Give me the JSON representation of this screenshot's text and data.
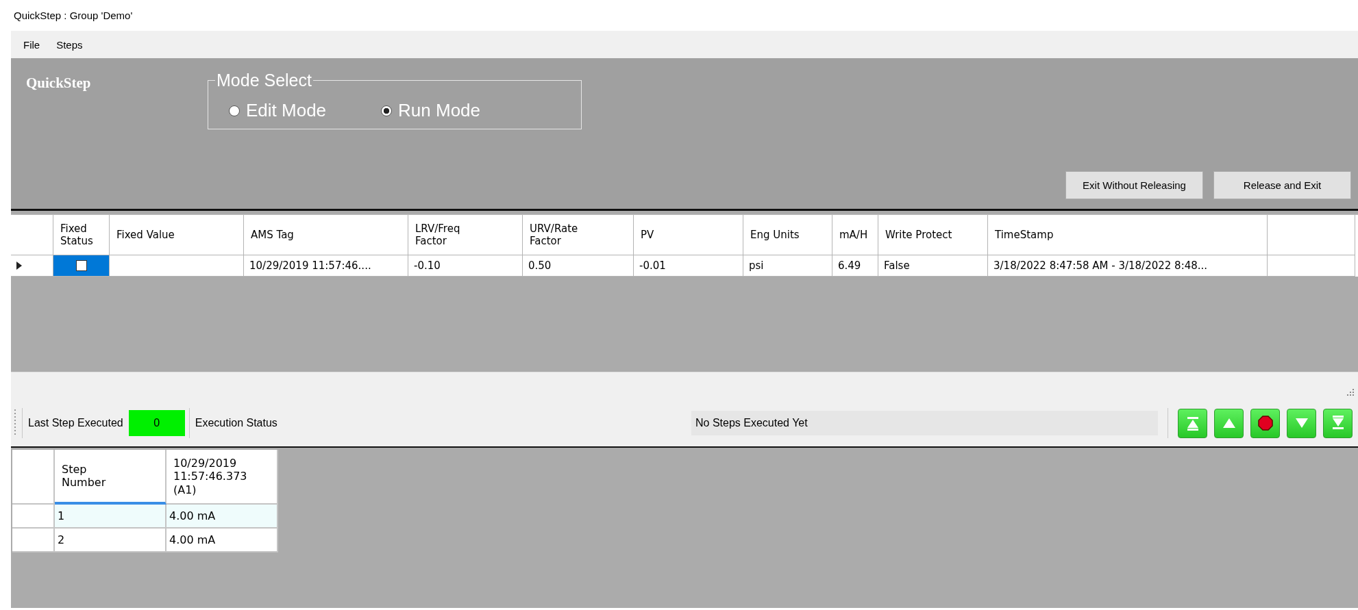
{
  "window": {
    "title": "QuickStep : Group 'Demo'"
  },
  "menu": [
    {
      "label": "File"
    },
    {
      "label": "Steps"
    }
  ],
  "header": {
    "title": "QuickStep",
    "mode_select": {
      "label": "Mode Select",
      "options": [
        {
          "label": "Edit Mode",
          "selected": false
        },
        {
          "label": "Run Mode",
          "selected": true
        }
      ]
    },
    "buttons": [
      "Exit Without Releasing",
      "Release and Exit"
    ]
  },
  "device_table": {
    "columns": [
      "Fixed\nStatus",
      "Fixed Value",
      "AMS Tag",
      "LRV/Freq\nFactor",
      "URV/Rate\nFactor",
      "PV",
      "Eng Units",
      "mA/H",
      "Write Protect",
      "TimeStamp"
    ],
    "rows": [
      {
        "current": true,
        "selected": true,
        "fixed_status": false,
        "cells": [
          "",
          "",
          "10/29/2019 11:57:46....",
          "-0.10",
          "0.50",
          "-0.01",
          "psi",
          "6.49",
          "False",
          "3/18/2022 8:47:58 AM - 3/18/2022 8:48..."
        ]
      }
    ]
  },
  "toolbar": {
    "last_step_label": "Last Step Executed",
    "last_step_value": "0",
    "status_label": "Execution Status",
    "status_value": "No Steps Executed Yet",
    "nav_buttons": [
      {
        "kind": "first"
      },
      {
        "kind": "up"
      },
      {
        "kind": "stop"
      },
      {
        "kind": "down"
      },
      {
        "kind": "last"
      }
    ]
  },
  "step_table": {
    "columns": [
      {
        "label": "Step\nNumber",
        "current": true
      },
      {
        "label": "10/29/2019\n11:57:46.373\n(A1)",
        "current": false
      }
    ],
    "rows": [
      {
        "selected": true,
        "cells": [
          "1",
          "4.00 mA"
        ]
      },
      {
        "selected": false,
        "cells": [
          "2",
          "4.00 mA"
        ]
      }
    ]
  }
}
